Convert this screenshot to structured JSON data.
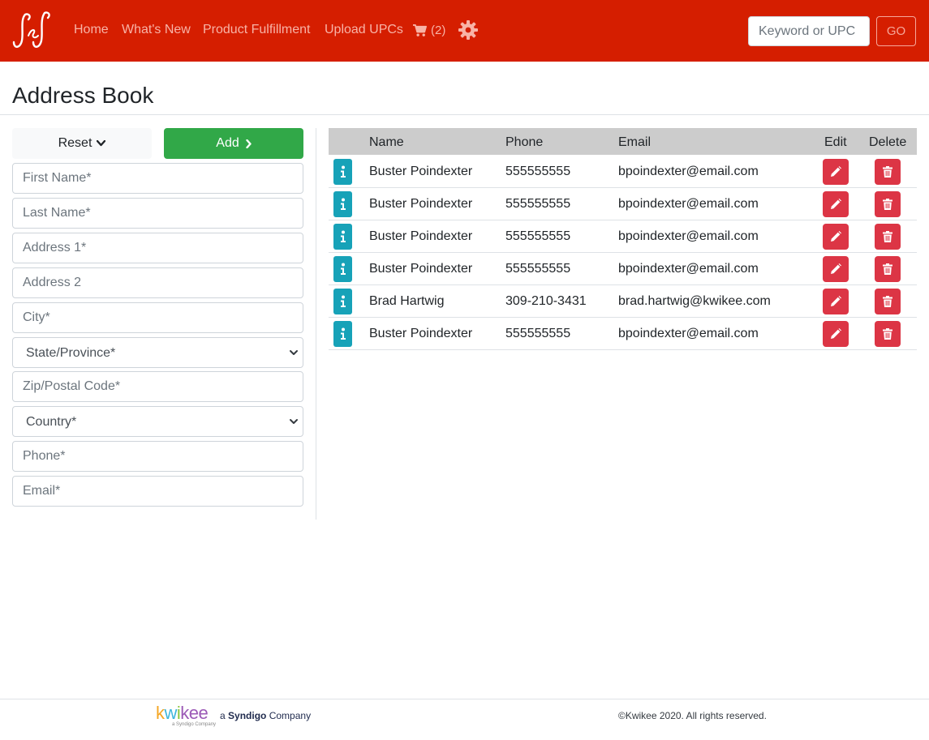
{
  "nav": {
    "logo_text": "J&J",
    "links": [
      "Home",
      "What's New",
      "Product Fulfillment",
      "Upload UPCs"
    ],
    "cart_count": "(2)",
    "search_placeholder": "Keyword or UPC",
    "go_label": "GO"
  },
  "page": {
    "title": "Address Book"
  },
  "form": {
    "reset_label": "Reset",
    "add_label": "Add",
    "first_name": "First Name*",
    "last_name": "Last Name*",
    "address1": "Address 1*",
    "address2": "Address 2",
    "city": "City*",
    "state": "State/Province*",
    "zip": "Zip/Postal Code*",
    "country": "Country*",
    "phone": "Phone*",
    "email": "Email*"
  },
  "table": {
    "headers": {
      "name": "Name",
      "phone": "Phone",
      "email": "Email",
      "edit": "Edit",
      "delete": "Delete"
    },
    "rows": [
      {
        "name": "Buster Poindexter",
        "phone": "555555555",
        "email": "bpoindexter@email.com"
      },
      {
        "name": "Buster Poindexter",
        "phone": "555555555",
        "email": "bpoindexter@email.com"
      },
      {
        "name": "Buster Poindexter",
        "phone": "555555555",
        "email": "bpoindexter@email.com"
      },
      {
        "name": "Buster Poindexter",
        "phone": "555555555",
        "email": "bpoindexter@email.com"
      },
      {
        "name": "Brad Hartwig",
        "phone": "309-210-3431",
        "email": "brad.hartwig@kwikee.com"
      },
      {
        "name": "Buster Poindexter",
        "phone": "555555555",
        "email": "bpoindexter@email.com"
      }
    ]
  },
  "footer": {
    "brand": "kwikee",
    "brand_sub": "a Syndigo Company",
    "a": "a",
    "syndigo": "Syndigo",
    "company": "Company",
    "copyright": "©Kwikee 2020. All rights reserved."
  },
  "colors": {
    "navbar": "#d51e00",
    "nav_link": "#f8b3a6",
    "add": "#31a848",
    "info": "#17a2b8",
    "danger": "#dc3545",
    "table_header": "#cccccc"
  },
  "icons": [
    "cart-icon",
    "gear-icon",
    "chevron-down-icon",
    "chevron-right-icon",
    "info-icon",
    "pencil-icon",
    "trash-icon"
  ]
}
